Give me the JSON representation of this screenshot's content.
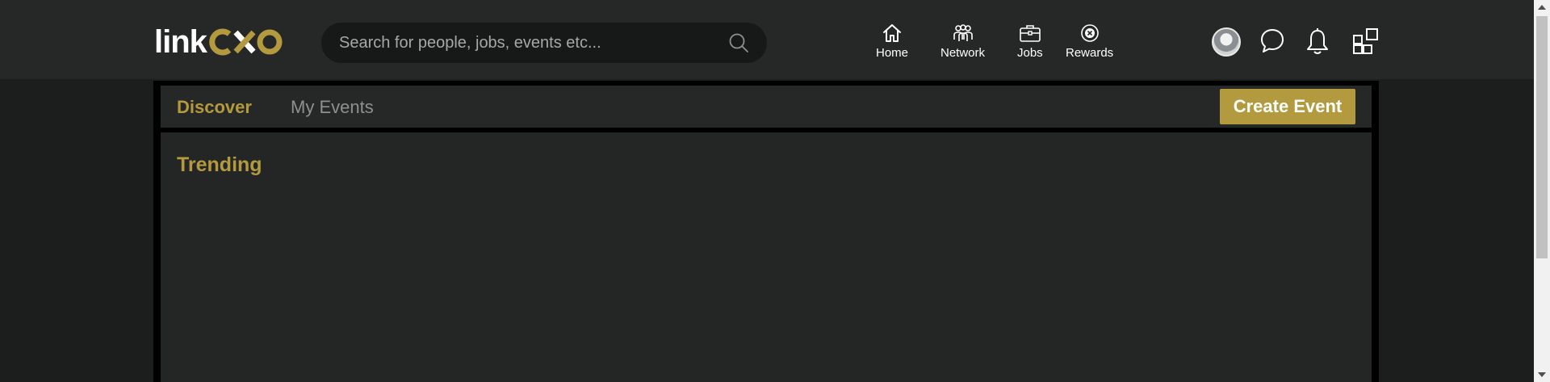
{
  "logo": {
    "part1": "link",
    "part2": "CXO"
  },
  "search": {
    "placeholder": "Search for people, jobs, events etc..."
  },
  "nav": {
    "items": [
      {
        "label": "Home",
        "icon": "home-icon"
      },
      {
        "label": "Network",
        "icon": "network-icon"
      },
      {
        "label": "Jobs",
        "icon": "briefcase-icon"
      },
      {
        "label": "Rewards",
        "icon": "rewards-icon"
      }
    ]
  },
  "user_tools": [
    "avatar",
    "chat-icon",
    "bell-icon",
    "apps-grid-icon"
  ],
  "tabs": [
    {
      "label": "Discover",
      "active": true
    },
    {
      "label": "My Events",
      "active": false
    }
  ],
  "create_event_label": "Create Event",
  "trending": {
    "title": "Trending"
  },
  "colors": {
    "accent": "#b39a3e",
    "topbar": "#262727",
    "background": "#1c1d1d",
    "panel": "#242525"
  }
}
